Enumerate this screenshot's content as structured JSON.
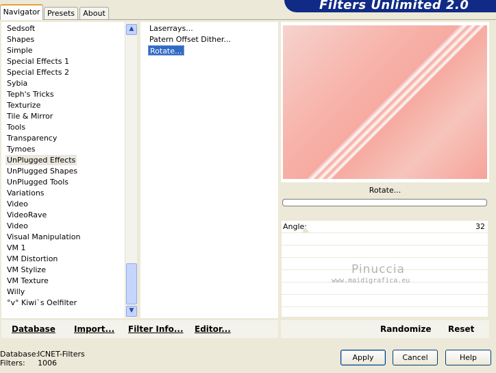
{
  "title": "Filters Unlimited 2.0",
  "tabs": [
    "Navigator",
    "Presets",
    "About"
  ],
  "categories": [
    "Sedsoft",
    "Shapes",
    "Simple",
    "Special Effects 1",
    "Special Effects 2",
    "Sybia",
    "Teph's Tricks",
    "Texturize",
    "Tile & Mirror",
    "Tools",
    "Transparency",
    "Tymoes",
    "UnPlugged Effects",
    "UnPlugged Shapes",
    "UnPlugged Tools",
    "Variations",
    "Video",
    "VideoRave",
    "Video",
    "Visual Manipulation",
    "VM 1",
    "VM Distortion",
    "VM Stylize",
    "VM Texture",
    "Willy",
    "°v° Kiwi`s Oelfilter"
  ],
  "selected_category": "UnPlugged Effects",
  "filters": [
    "Laserrays...",
    "Patern Offset Dither...",
    "Rotate..."
  ],
  "selected_filter": "Rotate...",
  "preview_caption": "Rotate...",
  "progress": 0,
  "params": [
    {
      "label": "Angle:",
      "value": "32"
    }
  ],
  "watermark": {
    "name": "Pinuccia",
    "url": "www.maidigrafica.eu"
  },
  "bottom_left": {
    "database": "Database",
    "import": "Import...",
    "filter_info": "Filter Info...",
    "editor": "Editor..."
  },
  "bottom_right": {
    "randomize": "Randomize",
    "reset": "Reset"
  },
  "status": {
    "database_label": "Database:",
    "database_value": "ICNET-Filters",
    "filters_label": "Filters:",
    "filters_value": "1006"
  },
  "buttons": {
    "apply": "Apply",
    "cancel": "Cancel",
    "help": "Help"
  },
  "colors": {
    "selection": "#316ac5",
    "title_banner": "#102a86",
    "preview_accent": "#f5a89d"
  }
}
